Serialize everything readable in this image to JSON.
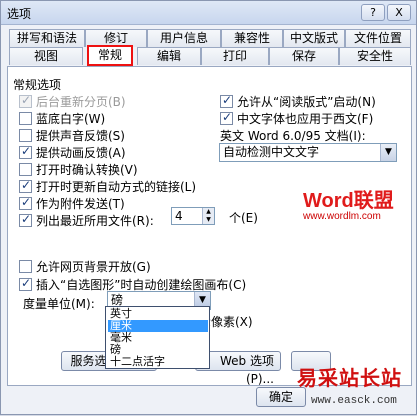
{
  "window": {
    "title": "选项",
    "help_btn": "?",
    "close_btn": "X"
  },
  "tabs_row1": [
    "拼写和语法",
    "修订",
    "用户信息",
    "兼容性",
    "中文版式",
    "文件位置"
  ],
  "tabs_row2": [
    "视图",
    "常规",
    "编辑",
    "打印",
    "保存",
    "安全性"
  ],
  "active_tab": "常规",
  "section_title": "常规选项",
  "left_options": [
    {
      "label": "后台重新分页(B)",
      "checked": true,
      "disabled": true
    },
    {
      "label": "蓝底白字(W)",
      "checked": false,
      "disabled": false
    },
    {
      "label": "提供声音反馈(S)",
      "checked": false,
      "disabled": false
    },
    {
      "label": "提供动画反馈(A)",
      "checked": true,
      "disabled": false
    },
    {
      "label": "打开时确认转换(V)",
      "checked": false,
      "disabled": false
    },
    {
      "label": "打开时更新自动方式的链接(L)",
      "checked": true,
      "disabled": false
    },
    {
      "label": "作为附件发送(T)",
      "checked": true,
      "disabled": false
    },
    {
      "label": "列出最近所用文件(R):",
      "checked": true,
      "disabled": false
    }
  ],
  "recent_files": {
    "value": "4",
    "unit": "个(E)"
  },
  "right_options": [
    {
      "label": "允许从“阅读版式”启动(N)",
      "checked": true
    },
    {
      "label": "中文字体也应用于西文(F)",
      "checked": true
    }
  ],
  "english_docs_label": "英文 Word 6.0/95 文档(I):",
  "english_docs_value": "自动检测中文文字",
  "lower_options": [
    {
      "label": "允许网页背景开放(G)",
      "checked": false
    },
    {
      "label": "插入“自选图形”时自动创建绘图画布(C)",
      "checked": true
    }
  ],
  "units_label": "度量单位(M):",
  "units_value": "磅",
  "units_options": [
    "英寸",
    "厘米",
    "毫米",
    "磅",
    "十二点活字"
  ],
  "units_selected": "厘米",
  "pixel_label_partial": "示像素(X)",
  "btn_services": "服务选项(V)...",
  "btn_web_options": "Web 选项(P)...",
  "btn_ok_partial": "确定",
  "watermark": {
    "logo": "Word联盟",
    "url": "www.wordlm.com",
    "site_text": "易采站长站",
    "site_url": "www.easck.com"
  }
}
